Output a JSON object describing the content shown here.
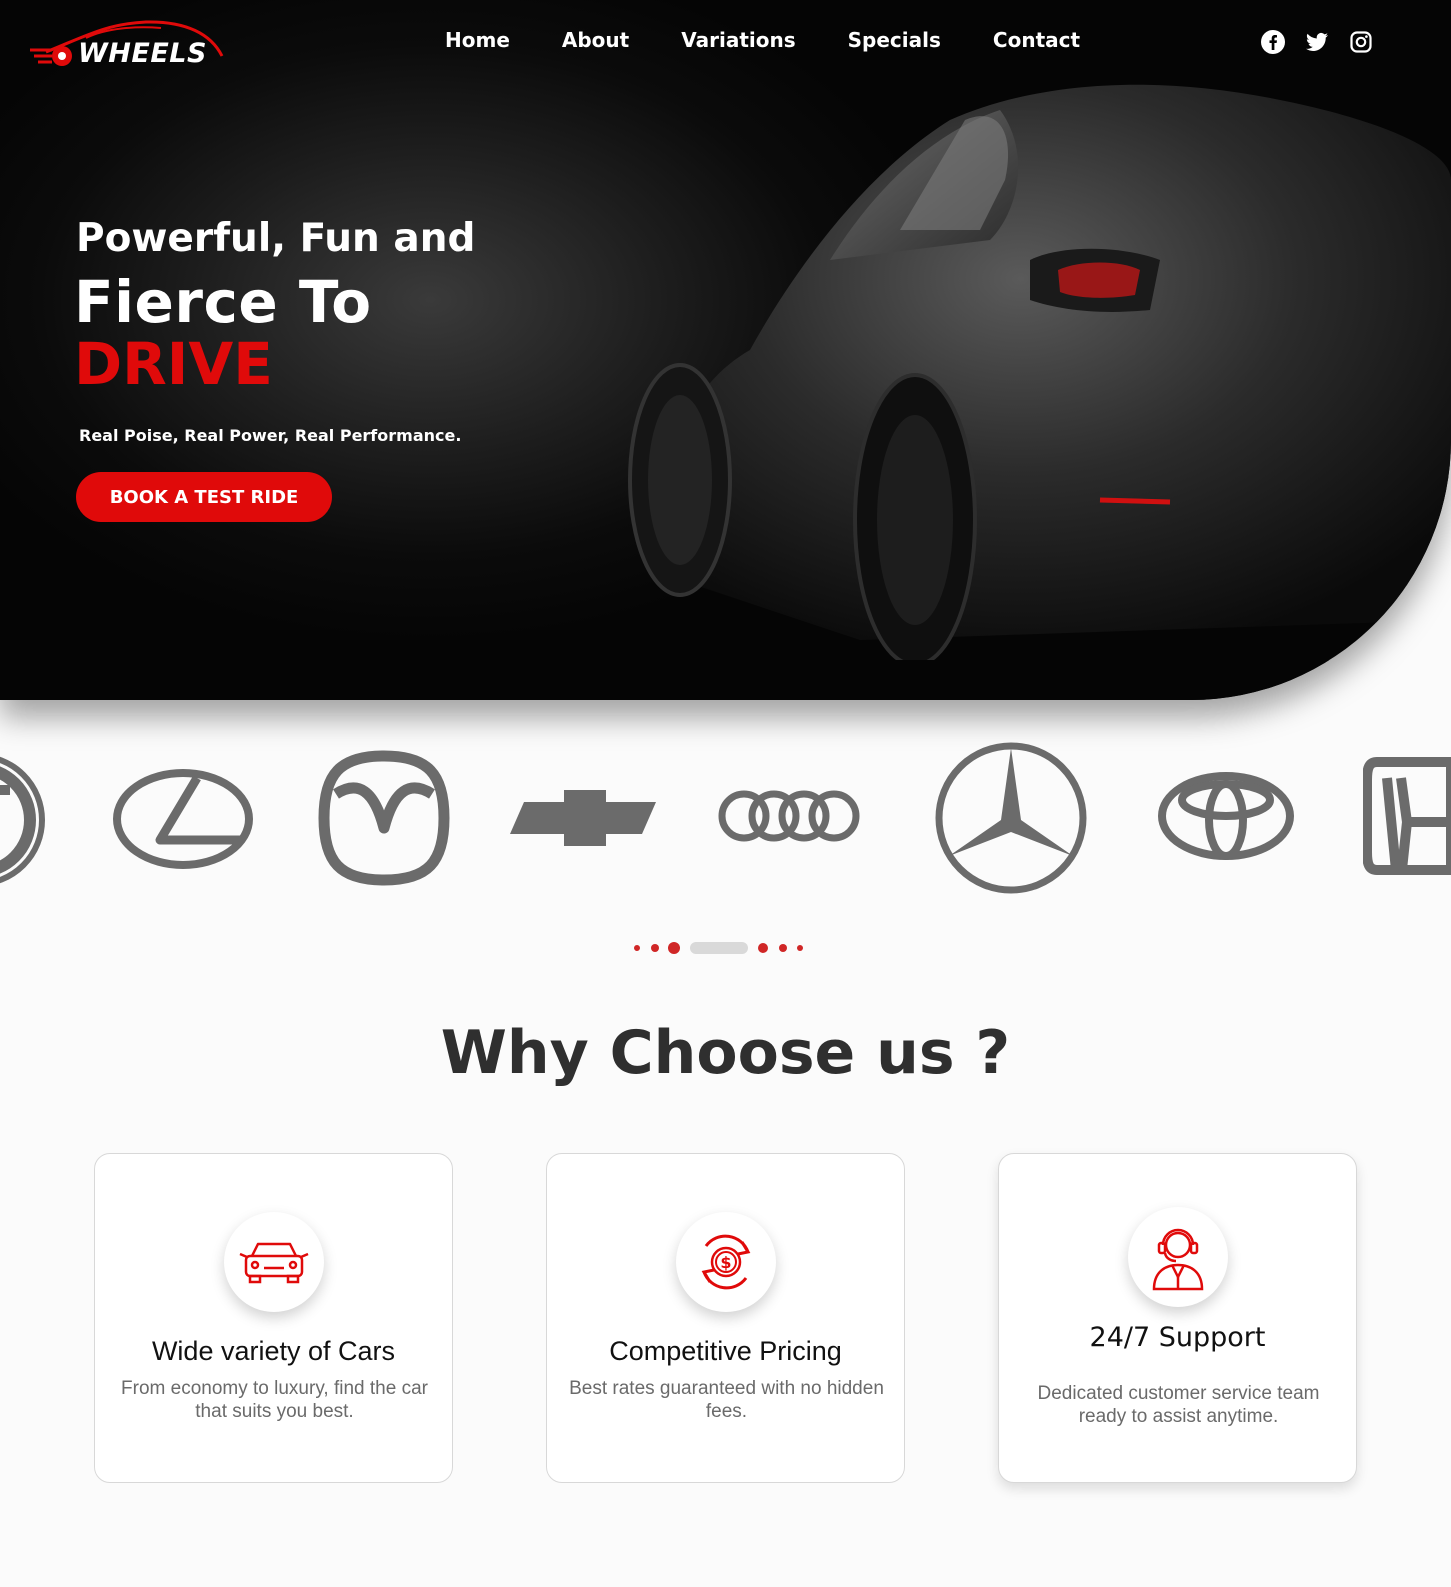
{
  "header": {
    "logo_text": "WHEELS",
    "nav": [
      "Home",
      "About",
      "Variations",
      "Specials",
      "Contact"
    ],
    "social_icons": [
      "facebook-icon",
      "twitter-icon",
      "instagram-icon"
    ]
  },
  "hero": {
    "line1": "Powerful, Fun and",
    "line2": "Fierce To",
    "line3": "DRIVE",
    "tagline": "Real Poise, Real Power, Real Performance.",
    "cta": "BOOK A TEST RIDE"
  },
  "brands": [
    "volkswagen-logo",
    "lexus-logo",
    "mazda-logo",
    "chevrolet-logo",
    "audi-logo",
    "mercedes-logo",
    "toyota-logo",
    "honda-logo"
  ],
  "carousel": {
    "active_index": 2,
    "total": 7
  },
  "why": {
    "title": "Why Choose us ?",
    "cards": [
      {
        "icon": "car-icon",
        "title": "Wide variety of Cars",
        "desc": "From economy to luxury, find the car that suits you best."
      },
      {
        "icon": "pricing-icon",
        "title": "Competitive Pricing",
        "desc": "Best rates guaranteed with no hidden fees."
      },
      {
        "icon": "support-icon",
        "title": "24/7 Support",
        "desc": "Dedicated customer service team ready to assist anytime."
      }
    ]
  },
  "colors": {
    "accent": "#e00a0a",
    "dark": "#0b0b0b",
    "logo_gray": "#6b6b6b"
  }
}
